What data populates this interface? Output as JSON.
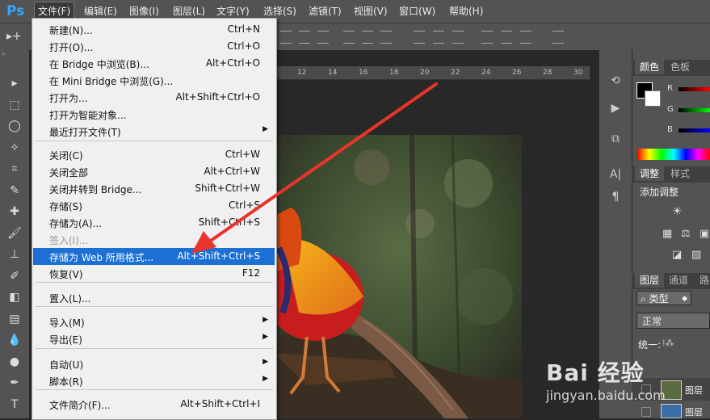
{
  "app": {
    "logo": "Ps"
  },
  "menubar": [
    {
      "label": "文件(F)",
      "active": true
    },
    {
      "label": "编辑(E)"
    },
    {
      "label": "图像(I)"
    },
    {
      "label": "图层(L)"
    },
    {
      "label": "文字(Y)"
    },
    {
      "label": "选择(S)"
    },
    {
      "label": "滤镜(T)"
    },
    {
      "label": "视图(V)"
    },
    {
      "label": "窗口(W)"
    },
    {
      "label": "帮助(H)"
    }
  ],
  "ruler_ticks": [
    "12",
    "14",
    "16",
    "18",
    "20",
    "22",
    "24",
    "26",
    "28",
    "30"
  ],
  "file_menu": [
    {
      "label": "新建(N)...",
      "shortcut": "Ctrl+N"
    },
    {
      "label": "打开(O)...",
      "shortcut": "Ctrl+O"
    },
    {
      "label": "在 Bridge 中浏览(B)...",
      "shortcut": "Alt+Ctrl+O"
    },
    {
      "label": "在 Mini Bridge 中浏览(G)...",
      "shortcut": ""
    },
    {
      "label": "打开为...",
      "shortcut": "Alt+Shift+Ctrl+O"
    },
    {
      "label": "打开为智能对象...",
      "shortcut": ""
    },
    {
      "label": "最近打开文件(T)",
      "shortcut": "",
      "submenu": true
    },
    {
      "label": "关闭(C)",
      "shortcut": "Ctrl+W"
    },
    {
      "label": "关闭全部",
      "shortcut": "Alt+Ctrl+W"
    },
    {
      "label": "关闭并转到 Bridge...",
      "shortcut": "Shift+Ctrl+W"
    },
    {
      "label": "存储(S)",
      "shortcut": "Ctrl+S"
    },
    {
      "label": "存储为(A)...",
      "shortcut": "Shift+Ctrl+S"
    },
    {
      "label": "签入(I)...",
      "shortcut": "",
      "disabled": true
    },
    {
      "label": "存储为 Web 所用格式...",
      "shortcut": "Alt+Shift+Ctrl+S",
      "highlighted": true
    },
    {
      "label": "恢复(V)",
      "shortcut": "F12"
    },
    {
      "label": "置入(L)...",
      "shortcut": ""
    },
    {
      "label": "导入(M)",
      "shortcut": "",
      "submenu": true
    },
    {
      "label": "导出(E)",
      "shortcut": "",
      "submenu": true
    },
    {
      "label": "自动(U)",
      "shortcut": "",
      "submenu": true
    },
    {
      "label": "脚本(R)",
      "shortcut": "",
      "submenu": true
    },
    {
      "label": "文件简介(F)...",
      "shortcut": "Alt+Shift+Ctrl+I"
    }
  ],
  "panels": {
    "color_tabs": [
      "颜色",
      "色板"
    ],
    "channels": [
      "R",
      "G",
      "B"
    ],
    "adjust_tabs": [
      "调整",
      "样式"
    ],
    "adjust_title": "添加调整",
    "layers_tabs": [
      "图层",
      "通道",
      "路"
    ],
    "kind_filter": "类型",
    "blend_mode": "正常",
    "unify_label": "统一:",
    "layer_names": [
      "图层",
      "图层"
    ]
  },
  "watermark": {
    "brand": "Bai 经验",
    "url": "jingyan.baidu.com"
  },
  "colors": {
    "highlight": "#1c6fd3",
    "ps_blue": "#31a8ff",
    "arrow": "#e8342d"
  }
}
